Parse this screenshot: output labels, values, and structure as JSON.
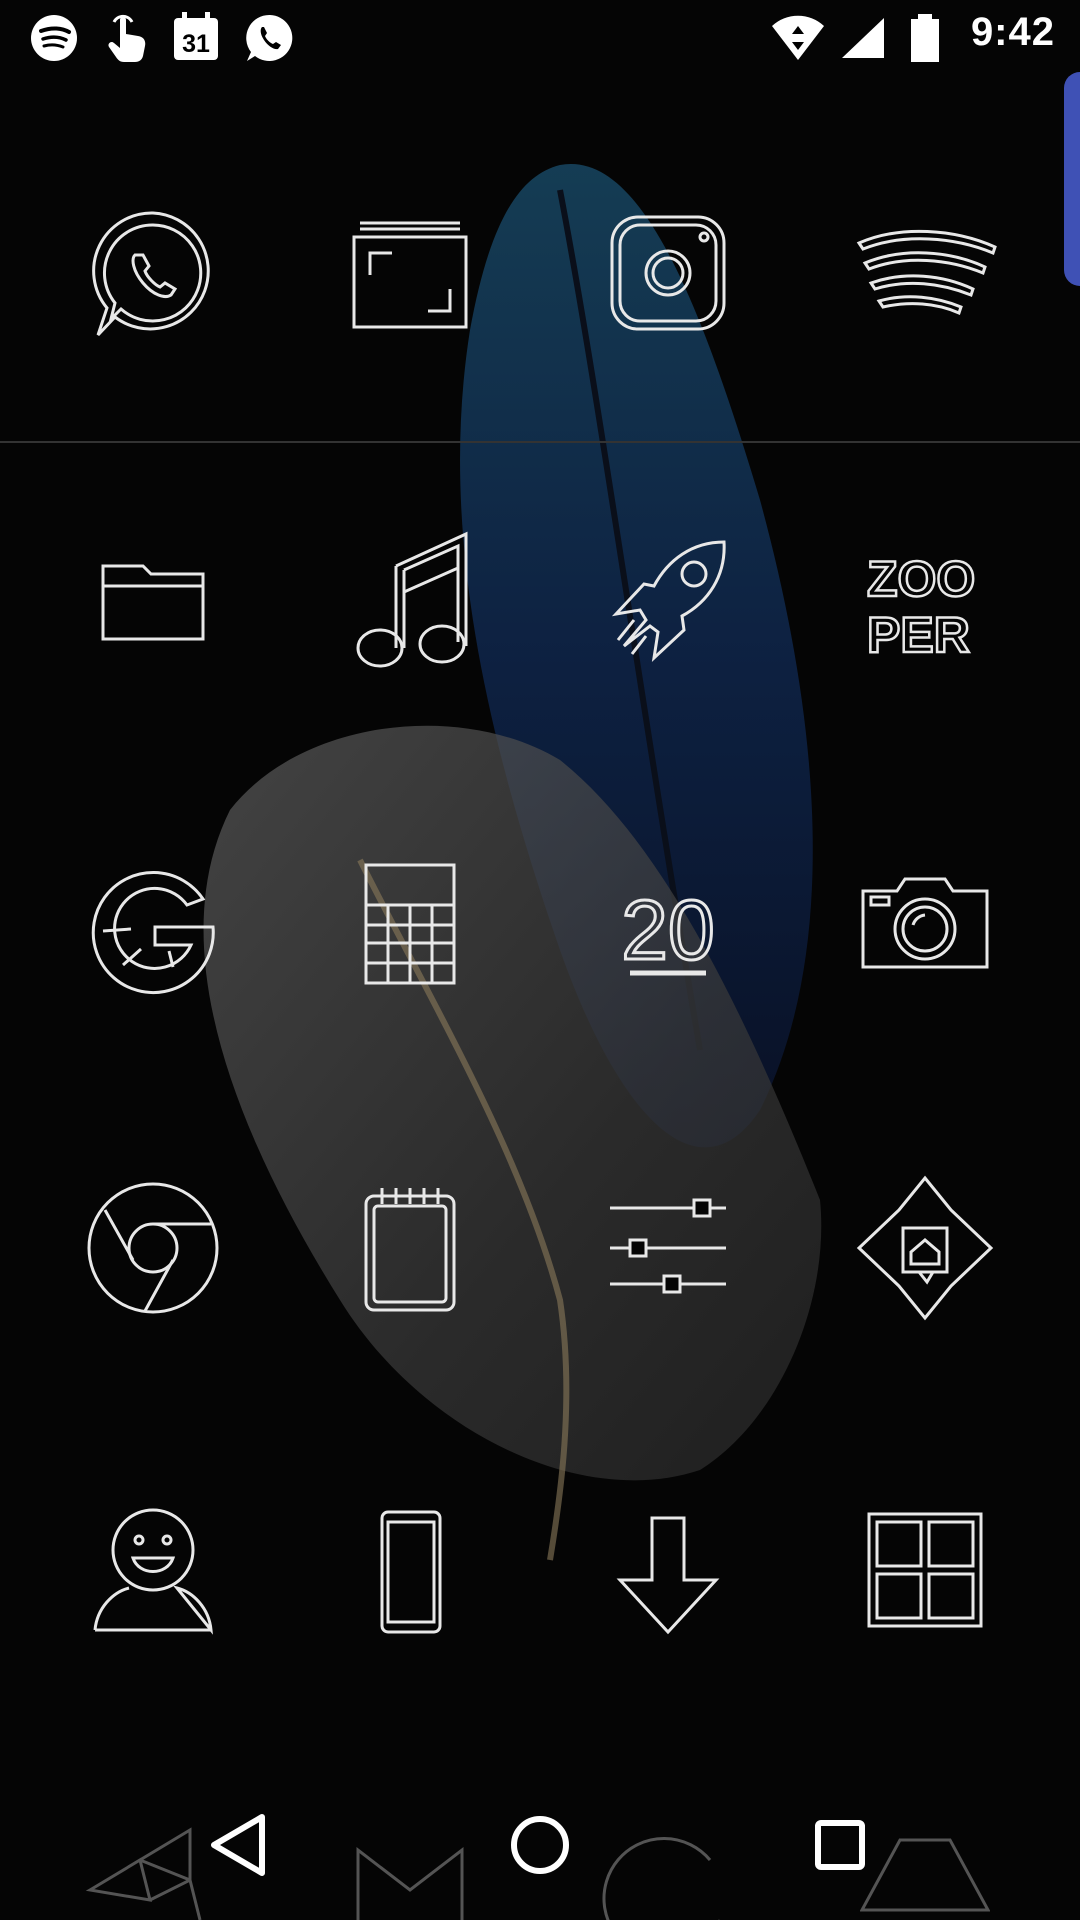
{
  "status_bar": {
    "notification_icons": [
      "spotify-icon",
      "tap-gesture-icon",
      "calendar-icon",
      "whatsapp-icon"
    ],
    "calendar_day": "31",
    "system_icons": [
      "wifi-icon",
      "cell-signal-icon",
      "battery-icon"
    ],
    "time": "9:42"
  },
  "home_screen": {
    "dock_row": [
      "whatsapp-icon",
      "gallery-icon",
      "instagram-icon",
      "spotify-icon"
    ],
    "grid_rows": [
      [
        "folder-icon",
        "music-icon",
        "rocket-icon",
        "zooper-icon"
      ],
      [
        "google-icon",
        "calendar-grid-icon",
        "date-20-icon",
        "camera-icon"
      ],
      [
        "chrome-icon",
        "notepad-icon",
        "settings-sliders-icon",
        "launcher-home-icon"
      ],
      [
        "contacts-icon",
        "phone-device-icon",
        "download-icon",
        "windows-grid-icon"
      ]
    ],
    "zooper_text_top": "ZOO",
    "zooper_text_bottom": "PER",
    "date_number": "20"
  },
  "navigation_bar": {
    "buttons": [
      "back-icon",
      "home-icon",
      "recents-icon"
    ]
  },
  "colors": {
    "background": "#050505",
    "edge_tab": "#3f51b5",
    "icon_stroke": "#e8e8e8"
  }
}
